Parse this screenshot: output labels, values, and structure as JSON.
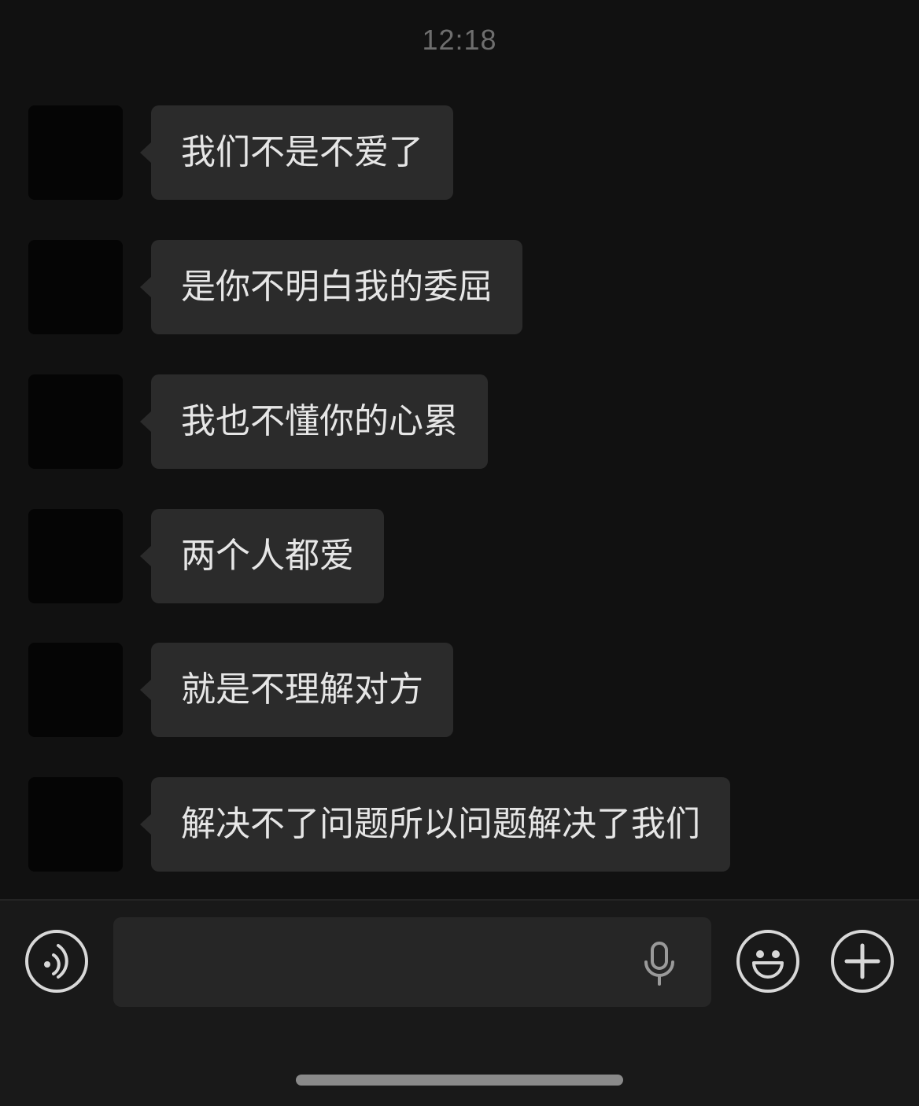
{
  "chat": {
    "timestamp": "12:18",
    "messages": [
      {
        "text": "我们不是不爱了"
      },
      {
        "text": "是你不明白我的委屈"
      },
      {
        "text": "我也不懂你的心累"
      },
      {
        "text": "两个人都爱"
      },
      {
        "text": "就是不理解对方"
      },
      {
        "text": "解决不了问题所以问题解决了我们"
      }
    ]
  },
  "input_bar": {
    "text_value": "",
    "icons": {
      "voice_toggle": "voice-wave-icon",
      "microphone": "microphone-icon",
      "emoji": "emoji-icon",
      "more": "plus-icon"
    }
  },
  "colors": {
    "background": "#111111",
    "bubble": "#2b2b2b",
    "bubble_text": "#e6e6e6",
    "timestamp": "#6e6e6e",
    "input_bar": "#191919",
    "icon": "#d8d8d8"
  }
}
